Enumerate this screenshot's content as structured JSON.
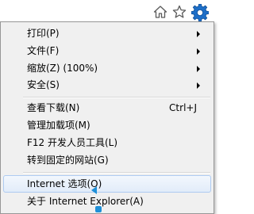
{
  "toolbar": {
    "icons": [
      "home-icon",
      "star-icon",
      "gear-icon"
    ]
  },
  "menu": {
    "items": [
      {
        "label": "打印(P)",
        "submenu": true
      },
      {
        "label": "文件(F)",
        "submenu": true
      },
      {
        "label": "缩放(Z) (100%)",
        "submenu": true
      },
      {
        "label": "安全(S)",
        "submenu": true
      },
      {
        "label": "查看下载(N)",
        "shortcut": "Ctrl+J"
      },
      {
        "label": "管理加载项(M)"
      },
      {
        "label": "F12 开发人员工具(L)"
      },
      {
        "label": "转到固定的网站(G)"
      },
      {
        "label": "Internet 选项(O)"
      },
      {
        "label": "关于 Internet Explorer(A)"
      }
    ]
  },
  "colors": {
    "menu_background": "#f0f0f0",
    "highlight_border": "#aecbf1",
    "gear_blue": "#1e6fc8"
  }
}
